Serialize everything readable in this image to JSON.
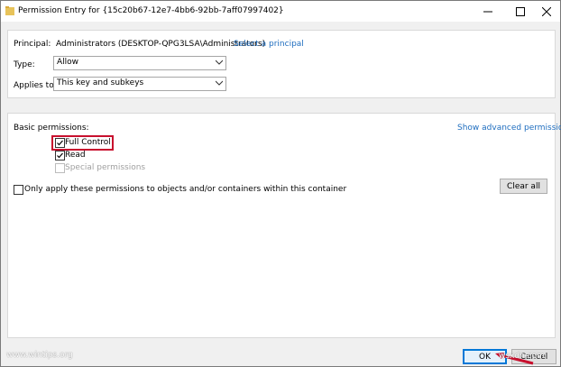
{
  "window": {
    "title": "Permission Entry for {15c20b67-12e7-4bb6-92bb-7aff07997402}",
    "icon": "folder-icon",
    "controls": [
      "minimize-icon",
      "maximize-icon",
      "close-icon"
    ]
  },
  "principal": {
    "label": "Principal:",
    "value": "Administrators (DESKTOP-QPG3LSA\\Administrators)",
    "link": "Select a principal"
  },
  "type": {
    "label": "Type:",
    "value": "Allow"
  },
  "applies_to": {
    "label": "Applies to:",
    "value": "This key and subkeys"
  },
  "permissions": {
    "heading": "Basic permissions:",
    "advanced_link": "Show advanced permissions",
    "items": [
      {
        "label": "Full Control",
        "checked": true,
        "enabled": true
      },
      {
        "label": "Read",
        "checked": true,
        "enabled": true
      },
      {
        "label": "Special permissions",
        "checked": false,
        "enabled": false
      }
    ],
    "only_apply": {
      "label": "Only apply these permissions to objects and/or containers within this container",
      "checked": false
    },
    "clear_all": "Clear all"
  },
  "footer": {
    "ok": "OK",
    "cancel": "Cancel"
  },
  "watermarks": {
    "left": "www.wintips.org",
    "right": "wsxdn.com"
  },
  "colors": {
    "link": "#1e6dbf",
    "highlight": "#c8102e",
    "ok_border": "#0078d7"
  }
}
